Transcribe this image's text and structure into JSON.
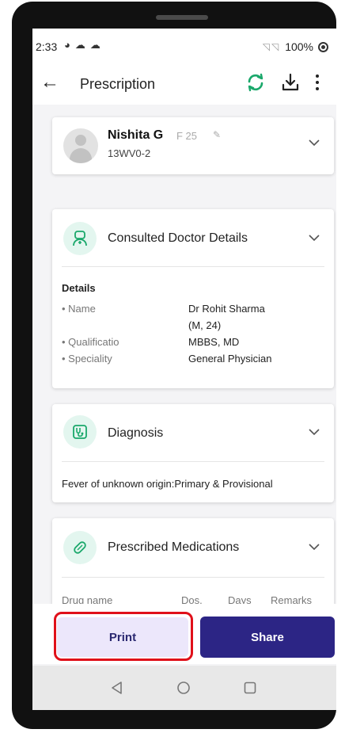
{
  "status_bar": {
    "time": "2:33",
    "left_icons": [
      "notification-icon",
      "cloud-icon",
      "cloud-icon"
    ],
    "signal_icons": [
      "no-signal-icon",
      "no-signal-icon"
    ],
    "battery": "100%"
  },
  "app_bar": {
    "title": "Prescription",
    "accent_color": "#1aa86b",
    "actions": [
      "sync-icon",
      "download-icon",
      "more-icon"
    ]
  },
  "patient": {
    "name": "Nishita G",
    "meta": "F 25",
    "id": "13WV0-2"
  },
  "doctor_section": {
    "title": "Consulted Doctor Details",
    "details_label": "Details",
    "rows": [
      {
        "label": "• Name",
        "value": "Dr Rohit Sharma"
      },
      {
        "label": "",
        "value": "(M, 24)"
      },
      {
        "label": "• Qualificatio",
        "value": "MBBS, MD"
      },
      {
        "label": "• Speciality",
        "value": "General Physician"
      }
    ]
  },
  "diagnosis_section": {
    "title": "Diagnosis",
    "text": "Fever of unknown origin:Primary & Provisional"
  },
  "medications_section": {
    "title": "Prescribed Medications",
    "columns": [
      "Drug name",
      "Dos.",
      "Days",
      "Remarks"
    ]
  },
  "actions": {
    "print_label": "Print",
    "share_label": "Share",
    "print_bg": "#ece7fb",
    "share_bg": "#2c2585",
    "highlight_color": "#e0101a"
  },
  "nav_bar": {
    "buttons": [
      "back-triangle-icon",
      "home-circle-icon",
      "recents-square-icon"
    ]
  }
}
